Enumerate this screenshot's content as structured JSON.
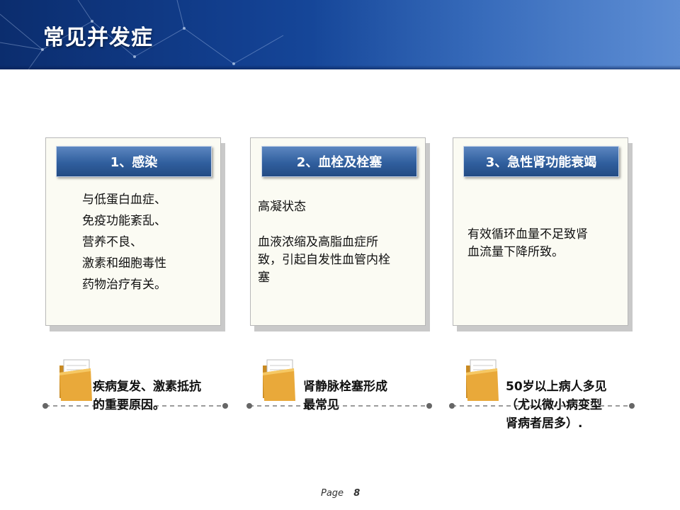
{
  "page": {
    "title": "常见并发症"
  },
  "cards": [
    {
      "heading": "1、感染",
      "body": "与低蛋白血症、\n免疫功能紊乱、\n  营养不良、\n激素和细胞毒性\n药物治疗有关。"
    },
    {
      "heading": "2、血栓及栓塞",
      "body": "  高凝状态\n\n  血液浓缩及高脂血症所\n致，引起自发性血管内栓\n塞"
    },
    {
      "heading": "3、急性肾功能衰竭",
      "body": "有效循环血量不足致肾\n血流量下降所致。"
    }
  ],
  "notes": [
    {
      "text": "疾病复发、激素抵抗\n  的重要原因。"
    },
    {
      "text": "肾静脉栓塞形成\n最常见"
    },
    {
      "text": "50岁以上病人多见\n（尤以微小病变型\n肾病者居多）."
    }
  ],
  "footer": {
    "page_label": "Page",
    "page_number": "8"
  },
  "colors": {
    "header_dark": "#0b2d6e",
    "header_light": "#2a66bf",
    "card_heading_bg": "#305f9e",
    "card_bg": "#fbfbf3",
    "folder": "#e9a93a"
  },
  "icons": {
    "folder": "folder-icon"
  }
}
